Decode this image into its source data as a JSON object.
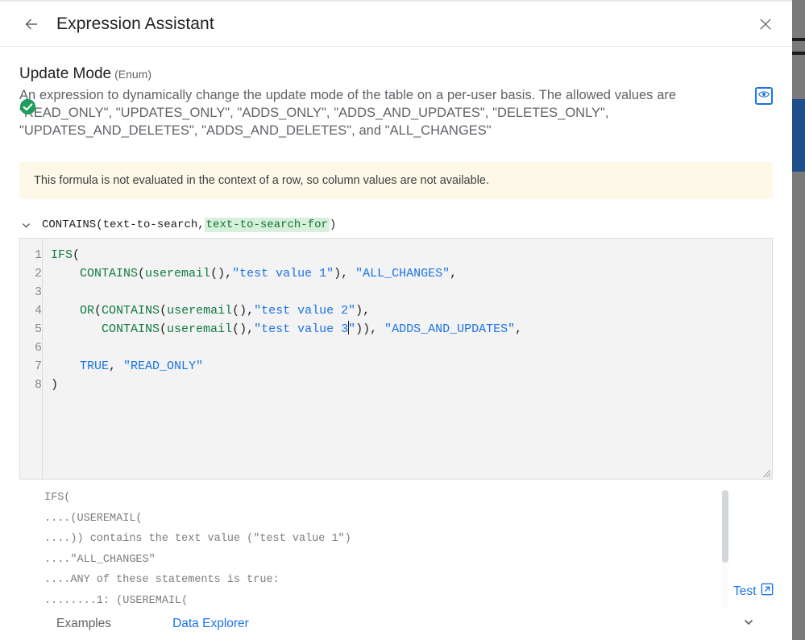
{
  "header": {
    "title": "Expression Assistant",
    "back_icon": "arrow-left-icon",
    "close_icon": "close-icon"
  },
  "property": {
    "name": "Update Mode",
    "type_label": "(Enum)",
    "description": "An expression to dynamically change the update mode of the table on a per-user basis. The allowed values are \"READ_ONLY\", \"UPDATES_ONLY\", \"ADDS_ONLY\", \"ADDS_AND_UPDATES\", \"DELETES_ONLY\", \"UPDATES_AND_DELETES\", \"ADDS_AND_DELETES\", and \"ALL_CHANGES\"",
    "preview_toggle_icon": "eye-icon"
  },
  "warning": {
    "text": "This formula is not evaluated in the context of a row, so column values are not available."
  },
  "signature_hint": {
    "chevron_icon": "chevron-down-icon",
    "function_name": "CONTAINS(",
    "param_1": "text-to-search, ",
    "param_2_active": "text-to-search-for",
    "close_paren": ")"
  },
  "editor": {
    "line_numbers": [
      "1",
      "2",
      "3",
      "4",
      "5",
      "6",
      "7",
      "8"
    ],
    "lines": [
      "IFS(",
      "    CONTAINS(useremail(),\"test value 1\"), \"ALL_CHANGES\",",
      "",
      "    OR(CONTAINS(useremail(),\"test value 2\"),",
      "       CONTAINS(useremail(),\"test value 3\")), \"ADDS_AND_UPDATES\",",
      "",
      "    TRUE, \"READ_ONLY\"",
      ")"
    ],
    "full_text": "IFS(\n    CONTAINS(useremail(),\"test value 1\"), \"ALL_CHANGES\",\n\n    OR(CONTAINS(useremail(),\"test value 2\"),\n       CONTAINS(useremail(),\"test value 3\")), \"ADDS_AND_UPDATES\",\n\n    TRUE, \"READ_ONLY\"\n)",
    "resize_handle": "resize-grip-icon"
  },
  "preview": {
    "status_icon": "check-circle-icon",
    "status_color": "#1e9e5a",
    "lines": [
      "IFS(",
      "....(USEREMAIL(",
      "....)) contains the text value (\"test value 1\")",
      "....\"ALL_CHANGES\"",
      "....ANY of these statements is true:",
      "........1: (USEREMAIL("
    ],
    "scrollbar": "preview-scrollbar"
  },
  "test": {
    "label": "Test",
    "icon": "external-link-icon"
  },
  "footer": {
    "examples_label": "Examples",
    "data_explorer_label": "Data Explorer",
    "expand_icon": "chevron-down-icon"
  },
  "colors": {
    "accent_blue": "#1a73e8",
    "function_green": "#0f7b3f",
    "warning_bg": "#fdf8e8",
    "editor_bg": "#f3f3f3",
    "success_green": "#1e9e5a"
  }
}
